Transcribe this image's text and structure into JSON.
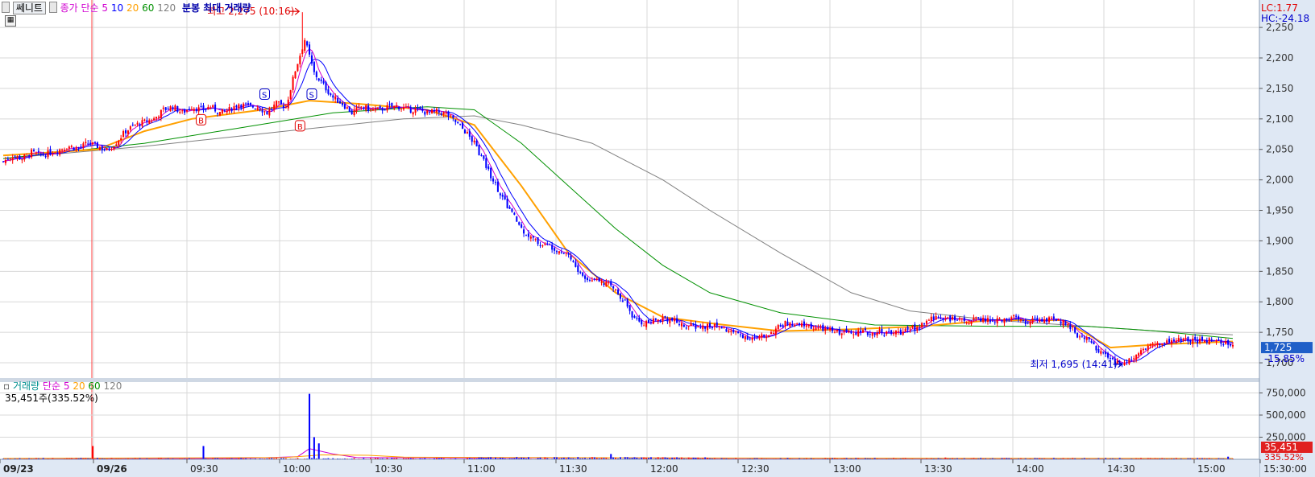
{
  "toolbar": {
    "stock_button": "쎄니트",
    "ma_label": "종가 단순",
    "ma_periods": [
      "5",
      "10",
      "20",
      "60",
      "120"
    ],
    "extra_label": "분봉 최대 거래량"
  },
  "volume_legend": {
    "title": "거래량",
    "ma_label": "단순",
    "ma_periods": [
      "5",
      "20",
      "60",
      "120"
    ],
    "current": "35,451주(335.52%)"
  },
  "top_right": {
    "lc": "LC:1.77",
    "hc": "HC:-24.18"
  },
  "price_tag": {
    "price": "1,725",
    "change": "-15.85%"
  },
  "volume_tag": {
    "value": "35,451",
    "pct": "335.52%"
  },
  "annotations": {
    "high": "최고 2,275 (10:16)",
    "low": "최저 1,695 (14:41)"
  },
  "signal_markers": {
    "b": "B",
    "s": "S"
  },
  "colors": {
    "up": "#ff0000",
    "down": "#0000ff",
    "ma5": "#d000d0",
    "ma10": "#0000ff",
    "ma20": "#ffa000",
    "ma60": "#009000",
    "ma120": "#808080",
    "axis_bg": "#dfe8f4",
    "grid": "#d8d8d8"
  },
  "chart_data": {
    "type": "candlestick",
    "interval": "1-minute",
    "y_ticks": [
      "2,250",
      "2,200",
      "2,150",
      "2,100",
      "2,050",
      "2,000",
      "1,950",
      "1,900",
      "1,850",
      "1,800",
      "1,750",
      "1,700"
    ],
    "ylim": [
      1675,
      2295
    ],
    "volume_ticks": [
      "750,000",
      "500,000",
      "250,000"
    ],
    "volume_ylim": [
      0,
      800000
    ],
    "x_labels": [
      "09/23",
      "09/26",
      "09:30",
      "10:00",
      "10:30",
      "11:00",
      "11:30",
      "12:00",
      "12:30",
      "13:00",
      "13:30",
      "14:00",
      "14:30",
      "15:00",
      "15:30:00"
    ],
    "high": 2275,
    "high_time": "10:16",
    "low": 1695,
    "low_time": "14:41",
    "last": 1725,
    "price_path": [
      [
        0,
        2030
      ],
      [
        4,
        2040
      ],
      [
        8,
        2035
      ],
      [
        12,
        2045
      ],
      [
        16,
        2040
      ],
      [
        20,
        2045
      ],
      [
        24,
        2050
      ],
      [
        28,
        2055
      ],
      [
        32,
        2052
      ],
      [
        36,
        2060
      ],
      [
        40,
        2055
      ],
      [
        44,
        2048
      ],
      [
        48,
        2062
      ],
      [
        52,
        2080
      ],
      [
        56,
        2090
      ],
      [
        60,
        2095
      ],
      [
        64,
        2100
      ],
      [
        68,
        2115
      ],
      [
        72,
        2120
      ],
      [
        76,
        2110
      ],
      [
        80,
        2120
      ],
      [
        84,
        2115
      ],
      [
        88,
        2120
      ],
      [
        92,
        2110
      ],
      [
        96,
        2115
      ],
      [
        100,
        2125
      ],
      [
        104,
        2120
      ],
      [
        108,
        2120
      ],
      [
        112,
        2110
      ],
      [
        116,
        2125
      ],
      [
        120,
        2120
      ],
      [
        124,
        2180
      ],
      [
        128,
        2230
      ],
      [
        132,
        2175
      ],
      [
        136,
        2155
      ],
      [
        140,
        2135
      ],
      [
        144,
        2125
      ],
      [
        148,
        2110
      ],
      [
        152,
        2120
      ],
      [
        156,
        2115
      ],
      [
        160,
        2115
      ],
      [
        164,
        2120
      ],
      [
        168,
        2120
      ],
      [
        172,
        2115
      ],
      [
        176,
        2115
      ],
      [
        180,
        2110
      ],
      [
        184,
        2112
      ],
      [
        188,
        2108
      ],
      [
        192,
        2095
      ],
      [
        196,
        2080
      ],
      [
        200,
        2060
      ],
      [
        204,
        2030
      ],
      [
        208,
        2000
      ],
      [
        212,
        1970
      ],
      [
        216,
        1945
      ],
      [
        220,
        1920
      ],
      [
        224,
        1905
      ],
      [
        228,
        1895
      ],
      [
        232,
        1892
      ],
      [
        236,
        1885
      ],
      [
        240,
        1878
      ],
      [
        244,
        1850
      ],
      [
        248,
        1835
      ],
      [
        252,
        1840
      ],
      [
        256,
        1830
      ],
      [
        260,
        1820
      ],
      [
        264,
        1800
      ],
      [
        268,
        1770
      ],
      [
        272,
        1765
      ],
      [
        276,
        1768
      ],
      [
        280,
        1775
      ],
      [
        284,
        1770
      ],
      [
        288,
        1762
      ],
      [
        292,
        1760
      ],
      [
        296,
        1758
      ],
      [
        300,
        1760
      ],
      [
        304,
        1760
      ],
      [
        308,
        1752
      ],
      [
        312,
        1748
      ],
      [
        316,
        1742
      ],
      [
        320,
        1740
      ],
      [
        324,
        1745
      ],
      [
        328,
        1755
      ],
      [
        332,
        1765
      ],
      [
        336,
        1760
      ],
      [
        340,
        1762
      ],
      [
        344,
        1758
      ],
      [
        348,
        1755
      ],
      [
        352,
        1752
      ],
      [
        356,
        1750
      ],
      [
        360,
        1752
      ],
      [
        364,
        1750
      ],
      [
        368,
        1748
      ],
      [
        372,
        1752
      ],
      [
        376,
        1748
      ],
      [
        380,
        1750
      ],
      [
        384,
        1754
      ],
      [
        388,
        1758
      ],
      [
        392,
        1768
      ],
      [
        396,
        1775
      ],
      [
        400,
        1775
      ],
      [
        404,
        1770
      ],
      [
        408,
        1768
      ],
      [
        412,
        1770
      ],
      [
        416,
        1772
      ],
      [
        420,
        1768
      ],
      [
        424,
        1770
      ],
      [
        428,
        1775
      ],
      [
        432,
        1768
      ],
      [
        436,
        1768
      ],
      [
        440,
        1772
      ],
      [
        444,
        1770
      ],
      [
        448,
        1768
      ],
      [
        452,
        1765
      ],
      [
        456,
        1745
      ],
      [
        460,
        1740
      ],
      [
        464,
        1725
      ],
      [
        468,
        1712
      ],
      [
        472,
        1700
      ],
      [
        476,
        1698
      ],
      [
        480,
        1712
      ],
      [
        484,
        1725
      ],
      [
        488,
        1730
      ],
      [
        492,
        1732
      ],
      [
        496,
        1735
      ],
      [
        500,
        1738
      ],
      [
        504,
        1736
      ],
      [
        508,
        1735
      ],
      [
        512,
        1737
      ],
      [
        516,
        1734
      ],
      [
        520,
        1730
      ],
      [
        522,
        1725
      ]
    ],
    "ma_curves": {
      "ma20": [
        [
          0,
          2040
        ],
        [
          40,
          2050
        ],
        [
          60,
          2080
        ],
        [
          80,
          2100
        ],
        [
          110,
          2115
        ],
        [
          130,
          2130
        ],
        [
          150,
          2125
        ],
        [
          180,
          2115
        ],
        [
          200,
          2090
        ],
        [
          220,
          1990
        ],
        [
          240,
          1880
        ],
        [
          260,
          1815
        ],
        [
          280,
          1775
        ],
        [
          300,
          1765
        ],
        [
          330,
          1752
        ],
        [
          360,
          1755
        ],
        [
          390,
          1760
        ],
        [
          420,
          1770
        ],
        [
          450,
          1770
        ],
        [
          470,
          1725
        ],
        [
          490,
          1730
        ],
        [
          522,
          1735
        ]
      ],
      "ma60": [
        [
          0,
          2035
        ],
        [
          60,
          2060
        ],
        [
          100,
          2085
        ],
        [
          140,
          2110
        ],
        [
          180,
          2120
        ],
        [
          200,
          2115
        ],
        [
          220,
          2060
        ],
        [
          240,
          1990
        ],
        [
          260,
          1920
        ],
        [
          280,
          1860
        ],
        [
          300,
          1815
        ],
        [
          330,
          1782
        ],
        [
          370,
          1762
        ],
        [
          420,
          1760
        ],
        [
          460,
          1760
        ],
        [
          490,
          1752
        ],
        [
          522,
          1740
        ]
      ],
      "ma120": [
        [
          0,
          2035
        ],
        [
          60,
          2055
        ],
        [
          120,
          2080
        ],
        [
          170,
          2100
        ],
        [
          200,
          2105
        ],
        [
          220,
          2090
        ],
        [
          250,
          2060
        ],
        [
          280,
          2000
        ],
        [
          300,
          1950
        ],
        [
          330,
          1880
        ],
        [
          360,
          1815
        ],
        [
          385,
          1785
        ],
        [
          420,
          1770
        ],
        [
          460,
          1760
        ],
        [
          490,
          1752
        ],
        [
          522,
          1746
        ]
      ]
    },
    "volume_spikes": [
      [
        38,
        150000
      ],
      [
        85,
        150000
      ],
      [
        130,
        740000
      ],
      [
        132,
        250000
      ],
      [
        134,
        180000
      ],
      [
        258,
        60000
      ],
      [
        400,
        20000
      ],
      [
        520,
        30000
      ]
    ]
  }
}
